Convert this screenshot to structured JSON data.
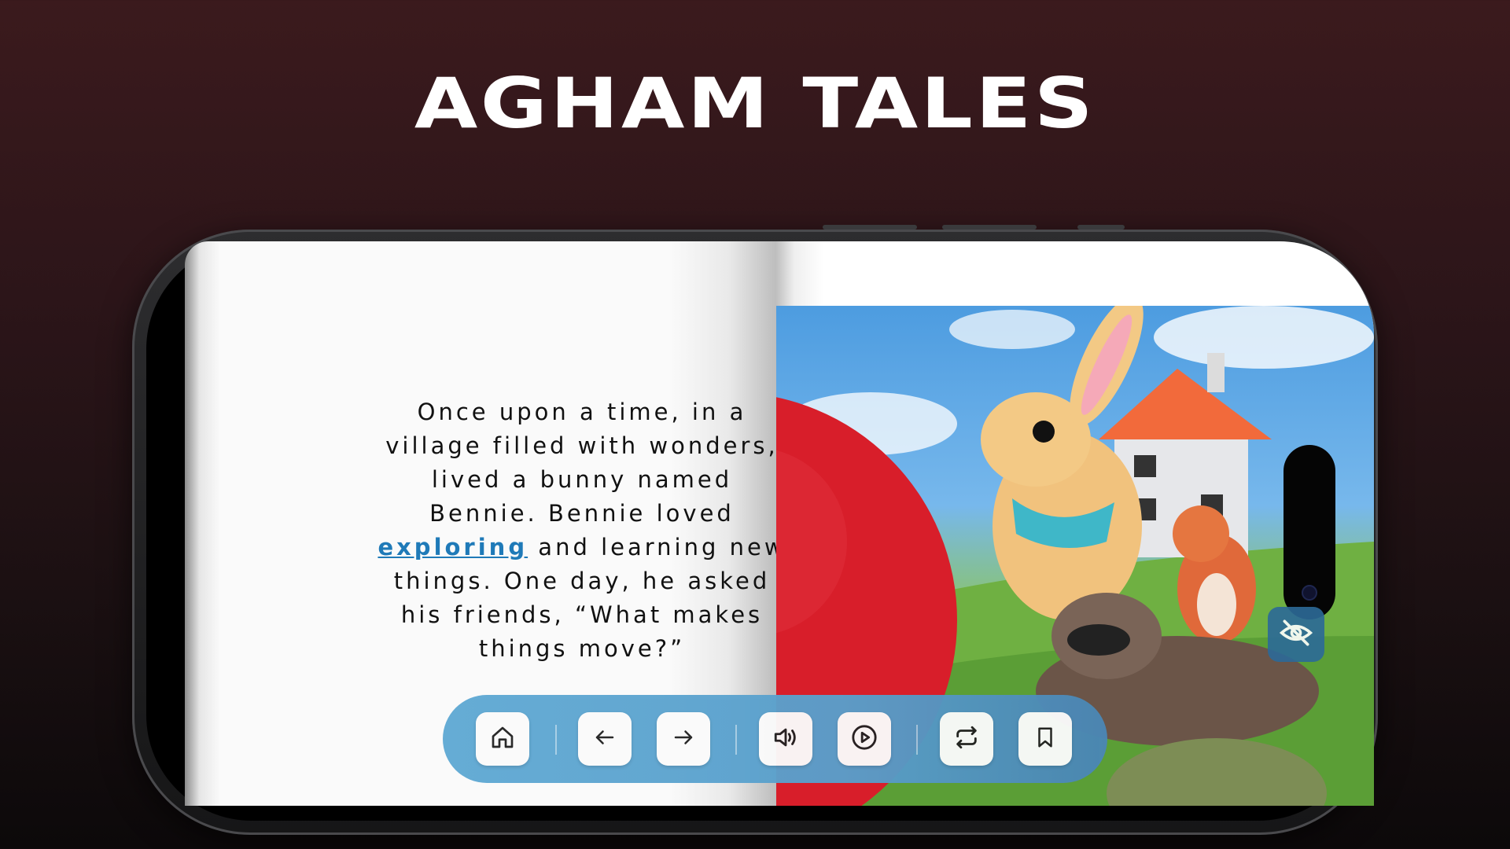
{
  "app": {
    "title": "AGHAM TALES"
  },
  "story": {
    "before_link": "Once upon a time, in a village filled with wonders, lived a bunny named Bennie. Bennie loved ",
    "link_word": "exploring",
    "after_link": " and learning new things. One day, he asked his friends, “What makes things move?”"
  },
  "toolbar": {
    "buttons": [
      {
        "name": "home",
        "icon": "home-icon"
      },
      {
        "name": "previous",
        "icon": "arrow-left-icon"
      },
      {
        "name": "next",
        "icon": "arrow-right-icon"
      },
      {
        "name": "audio",
        "icon": "speaker-icon"
      },
      {
        "name": "play",
        "icon": "play-circle-icon"
      },
      {
        "name": "repeat",
        "icon": "repeat-icon"
      },
      {
        "name": "bookmark",
        "icon": "bookmark-icon"
      }
    ]
  },
  "overlay": {
    "hide_icon": "eye-off-icon"
  },
  "colors": {
    "background_top": "#3b1a1d",
    "toolbar": "#5fa9d4",
    "link": "#1f7ab8",
    "ball": "#d81e2a"
  }
}
